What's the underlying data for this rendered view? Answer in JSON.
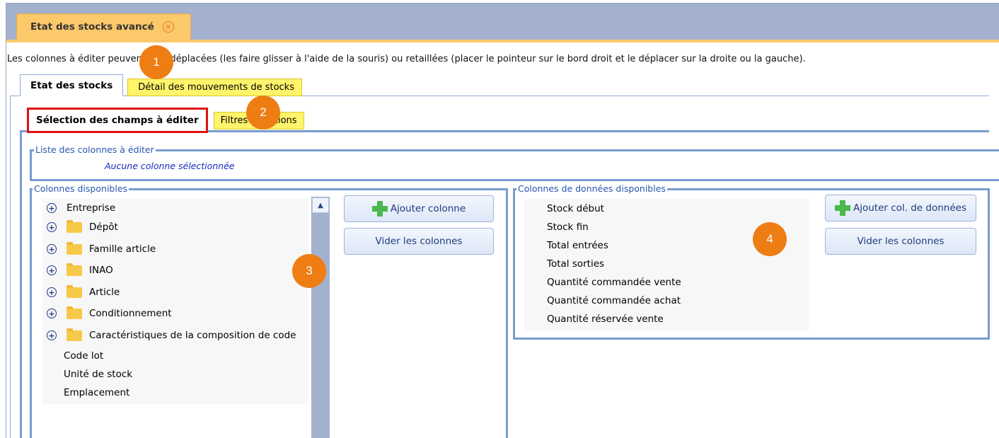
{
  "window": {
    "doc_tab_title": "Etat des stocks avancé"
  },
  "info_text": "Les colonnes à éditer peuvent être déplacées (les faire glisser à l'aide de la souris) ou retaillées (placer le pointeur sur le bord droit et le déplacer sur la droite ou la gauche).",
  "main_tabs": [
    {
      "label": "Etat des stocks",
      "active": true
    },
    {
      "label": "Détail des mouvements de stocks",
      "active": false
    }
  ],
  "sub_tabs": [
    {
      "label": "Sélection des champs à éditer",
      "active": true
    },
    {
      "label": "Filtres et options",
      "active": false
    }
  ],
  "column_list": {
    "legend": "Liste des colonnes à éditer",
    "empty_text": "Aucune colonne sélectionnée"
  },
  "available_columns": {
    "legend": "Colonnes disponibles",
    "tree": [
      {
        "label": "Entreprise",
        "expandable": true,
        "folder": false
      },
      {
        "label": "Dépôt",
        "expandable": true,
        "folder": true
      },
      {
        "label": "Famille article",
        "expandable": true,
        "folder": true
      },
      {
        "label": "INAO",
        "expandable": true,
        "folder": true
      },
      {
        "label": "Article",
        "expandable": true,
        "folder": true
      },
      {
        "label": "Conditionnement",
        "expandable": true,
        "folder": true
      },
      {
        "label": "Caractéristiques de la composition de code",
        "expandable": true,
        "folder": true
      },
      {
        "label": "Code lot",
        "expandable": false,
        "folder": false
      },
      {
        "label": "Unité de stock",
        "expandable": false,
        "folder": false
      },
      {
        "label": "Emplacement",
        "expandable": false,
        "folder": false
      }
    ],
    "add_button": "Ajouter colonne",
    "clear_button": "Vider les colonnes"
  },
  "data_columns": {
    "legend": "Colonnes de données disponibles",
    "items": [
      "Stock début",
      "Stock fin",
      "Total entrées",
      "Total sorties",
      "Quantité commandée vente",
      "Quantité commandée achat",
      "Quantité réservée vente"
    ],
    "add_button": "Ajouter col. de données",
    "clear_button": "Vider les colonnes"
  },
  "badges": [
    "1",
    "2",
    "3",
    "4"
  ],
  "colors": {
    "header_bar": "#a3b1cf",
    "doc_tab": "#fbc86a",
    "inactive_tab": "#fff46a",
    "highlight_border": "#e01010",
    "badge": "#ee7d14",
    "fieldset_border": "#7a9bd0"
  }
}
